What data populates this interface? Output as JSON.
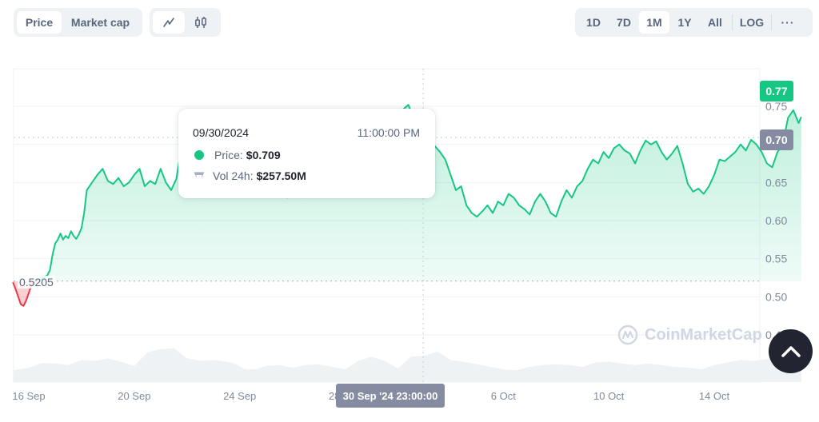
{
  "toolbar": {
    "type_tabs": [
      {
        "label": "Price",
        "active": true
      },
      {
        "label": "Market cap",
        "active": false
      }
    ],
    "style_tabs": [
      {
        "icon": "line-chart-icon",
        "active": true
      },
      {
        "icon": "candlestick-icon",
        "active": false
      }
    ],
    "range_tabs": [
      {
        "label": "1D",
        "active": false
      },
      {
        "label": "7D",
        "active": false
      },
      {
        "label": "1M",
        "active": true
      },
      {
        "label": "1Y",
        "active": false
      },
      {
        "label": "All",
        "active": false
      }
    ],
    "log_label": "LOG",
    "more_label": "···"
  },
  "tooltip": {
    "date": "09/30/2024",
    "time": "11:00:00 PM",
    "price_label": "Price:",
    "price_value": "$0.709",
    "volume_label": "Vol 24h:",
    "volume_value": "$257.50M"
  },
  "badges": {
    "current_price": "0.77",
    "hover_price": "0.70",
    "hover_x_label": "30 Sep '24 23:00:00",
    "start_price": "0.5205"
  },
  "watermark": "CoinMarketCap",
  "colors": {
    "up": "#16c784",
    "down": "#ea3943",
    "hover_badge": "#858ca2",
    "volume": "#eff2f5"
  },
  "chart_data": {
    "type": "area",
    "title": "",
    "xlabel": "",
    "ylabel": "",
    "x_unit": "days since 16 Sep 2024",
    "x_ticks": [
      {
        "x": 0,
        "label": "16 Sep"
      },
      {
        "x": 4,
        "label": "20 Sep"
      },
      {
        "x": 8,
        "label": "24 Sep"
      },
      {
        "x": 12,
        "label": "28 Sep"
      },
      {
        "x": 18,
        "label": "6 Oct"
      },
      {
        "x": 22,
        "label": "10 Oct"
      },
      {
        "x": 26,
        "label": "14 Oct"
      }
    ],
    "y_ticks": [
      0.45,
      0.5,
      0.55,
      0.6,
      0.65,
      0.7,
      0.75
    ],
    "ylim": [
      0.4,
      0.79
    ],
    "xlim": [
      -0.6,
      29.3
    ],
    "baseline": 0.5205,
    "hover": {
      "x": 14.96,
      "price": 0.709
    },
    "grid": true,
    "legend": "none",
    "series": [
      {
        "name": "Price",
        "x": [
          -0.6,
          -0.5,
          -0.4,
          -0.3,
          -0.2,
          -0.1,
          0.0,
          0.1,
          0.2,
          0.3,
          0.4,
          0.5,
          0.6,
          0.7,
          0.8,
          0.9,
          1.0,
          1.1,
          1.2,
          1.3,
          1.4,
          1.5,
          1.6,
          1.7,
          1.8,
          1.9,
          2.0,
          2.1,
          2.2,
          2.4,
          2.6,
          2.8,
          3.0,
          3.2,
          3.4,
          3.6,
          3.8,
          4.0,
          4.2,
          4.4,
          4.6,
          4.8,
          5.0,
          5.2,
          5.4,
          5.6,
          5.8,
          5.9,
          6.0,
          6.1,
          6.2,
          6.4,
          6.6,
          6.8,
          7.0,
          7.2,
          7.4,
          7.6,
          7.8,
          8.0,
          8.2,
          8.4,
          8.6,
          8.8,
          9.0,
          9.2,
          9.4,
          9.6,
          9.8,
          10.0,
          10.2,
          10.4,
          10.6,
          10.8,
          11.0,
          11.2,
          11.4,
          11.6,
          11.8,
          12.0,
          12.2,
          12.4,
          12.6,
          12.8,
          13.0,
          13.2,
          13.4,
          13.6,
          13.8,
          14.0,
          14.2,
          14.4,
          14.6,
          14.8,
          15.0,
          15.2,
          15.4,
          15.6,
          15.8,
          16.0,
          16.2,
          16.4,
          16.6,
          16.8,
          17.0,
          17.2,
          17.4,
          17.6,
          17.8,
          18.0,
          18.2,
          18.4,
          18.6,
          18.8,
          19.0,
          19.2,
          19.4,
          19.6,
          19.8,
          20.0,
          20.2,
          20.4,
          20.6,
          20.8,
          21.0,
          21.2,
          21.4,
          21.6,
          21.8,
          22.0,
          22.2,
          22.4,
          22.6,
          22.8,
          23.0,
          23.2,
          23.4,
          23.6,
          23.8,
          24.0,
          24.2,
          24.4,
          24.6,
          24.8,
          25.0,
          25.2,
          25.4,
          25.6,
          25.8,
          26.0,
          26.2,
          26.4,
          26.6,
          26.8,
          27.0,
          27.2,
          27.4,
          27.6,
          27.8,
          28.0,
          28.2,
          28.4,
          28.6,
          28.8,
          29.0,
          29.2,
          29.3
        ],
        "values": [
          0.519,
          0.51,
          0.5,
          0.49,
          0.488,
          0.495,
          0.505,
          0.515,
          0.52,
          0.521,
          0.522,
          0.524,
          0.526,
          0.528,
          0.535,
          0.555,
          0.57,
          0.575,
          0.583,
          0.575,
          0.58,
          0.577,
          0.586,
          0.58,
          0.576,
          0.582,
          0.59,
          0.61,
          0.64,
          0.65,
          0.66,
          0.668,
          0.652,
          0.648,
          0.656,
          0.645,
          0.65,
          0.66,
          0.668,
          0.645,
          0.652,
          0.648,
          0.668,
          0.65,
          0.64,
          0.655,
          0.7,
          0.716,
          0.7,
          0.692,
          0.68,
          0.668,
          0.665,
          0.655,
          0.65,
          0.66,
          0.65,
          0.665,
          0.672,
          0.66,
          0.657,
          0.65,
          0.64,
          0.652,
          0.648,
          0.65,
          0.66,
          0.656,
          0.63,
          0.66,
          0.648,
          0.655,
          0.645,
          0.64,
          0.655,
          0.66,
          0.652,
          0.65,
          0.64,
          0.655,
          0.662,
          0.65,
          0.648,
          0.66,
          0.668,
          0.655,
          0.65,
          0.665,
          0.68,
          0.7,
          0.746,
          0.752,
          0.735,
          0.72,
          0.705,
          0.709,
          0.698,
          0.69,
          0.68,
          0.66,
          0.64,
          0.645,
          0.62,
          0.61,
          0.605,
          0.612,
          0.62,
          0.61,
          0.625,
          0.62,
          0.635,
          0.63,
          0.62,
          0.615,
          0.608,
          0.625,
          0.635,
          0.625,
          0.61,
          0.605,
          0.625,
          0.64,
          0.63,
          0.645,
          0.652,
          0.668,
          0.68,
          0.675,
          0.69,
          0.682,
          0.695,
          0.7,
          0.692,
          0.688,
          0.675,
          0.692,
          0.705,
          0.7,
          0.704,
          0.69,
          0.68,
          0.688,
          0.698,
          0.675,
          0.648,
          0.638,
          0.642,
          0.635,
          0.645,
          0.66,
          0.68,
          0.678,
          0.684,
          0.69,
          0.7,
          0.692,
          0.706,
          0.7,
          0.69,
          0.675,
          0.67,
          0.69,
          0.7,
          0.735,
          0.745,
          0.728,
          0.736,
          0.74,
          0.76,
          0.744,
          0.77,
          0.765,
          0.772
        ]
      },
      {
        "name": "Volume (relative)",
        "x": [
          -0.6,
          0.0,
          0.5,
          1.0,
          1.5,
          2.0,
          2.5,
          3.0,
          3.5,
          4.0,
          4.5,
          5.0,
          5.5,
          6.0,
          6.5,
          7.0,
          7.5,
          7.8,
          8.2,
          8.6,
          9.0,
          9.5,
          10.0,
          10.5,
          11.0,
          11.5,
          12.0,
          12.5,
          13.0,
          13.5,
          14.0,
          14.5,
          15.0,
          15.5,
          16.0,
          16.5,
          17.0,
          17.5,
          18.0,
          18.5,
          19.0,
          19.5,
          20.0,
          20.5,
          21.0,
          21.5,
          22.0,
          22.5,
          23.0,
          23.5,
          24.0,
          24.5,
          25.0,
          25.5,
          26.0,
          26.5,
          27.0,
          27.5,
          28.0,
          28.5,
          29.3
        ],
        "values": [
          0.28,
          0.34,
          0.45,
          0.44,
          0.4,
          0.52,
          0.5,
          0.56,
          0.48,
          0.38,
          0.7,
          0.78,
          0.8,
          0.56,
          0.5,
          0.52,
          0.48,
          0.44,
          0.3,
          0.3,
          0.38,
          0.4,
          0.34,
          0.4,
          0.42,
          0.36,
          0.3,
          0.5,
          0.6,
          0.5,
          0.32,
          0.6,
          0.62,
          0.72,
          0.52,
          0.48,
          0.42,
          0.36,
          0.3,
          0.28,
          0.36,
          0.4,
          0.42,
          0.4,
          0.36,
          0.46,
          0.48,
          0.44,
          0.4,
          0.44,
          0.4,
          0.36,
          0.34,
          0.3,
          0.4,
          0.46,
          0.52,
          0.5,
          0.54,
          0.6,
          0.78
        ]
      }
    ]
  }
}
